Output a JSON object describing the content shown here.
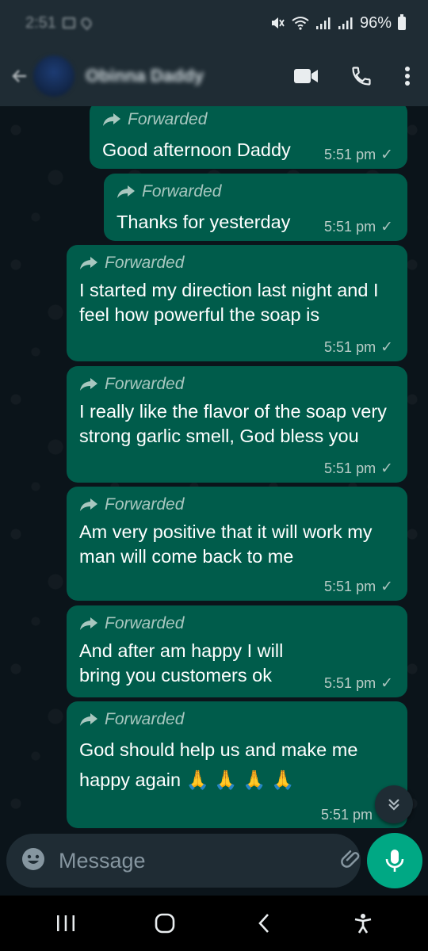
{
  "status_bar": {
    "time": "2:51",
    "battery": "96%",
    "icons": [
      "image-icon",
      "location-icon",
      "mute-icon",
      "wifi-icon",
      "signal-icon",
      "signal-icon",
      "battery-icon"
    ]
  },
  "header": {
    "contact_name": "Obinna Daddy",
    "actions": [
      "video-call-icon",
      "voice-call-icon",
      "more-options-icon"
    ]
  },
  "messages": [
    {
      "forwarded_label": "Forwarded",
      "text": "Good afternoon Daddy",
      "time": "5:51 pm",
      "status": "sent-check"
    },
    {
      "forwarded_label": "Forwarded",
      "text": "Thanks for yesterday",
      "time": "5:51 pm",
      "status": "sent-check"
    },
    {
      "forwarded_label": "Forwarded",
      "text": "I started my direction last night and I feel how powerful the soap is",
      "time": "5:51 pm",
      "status": "sent-check"
    },
    {
      "forwarded_label": "Forwarded",
      "text": "I really like the flavor of the soap very strong garlic smell, God bless you",
      "time": "5:51 pm",
      "status": "sent-check"
    },
    {
      "forwarded_label": "Forwarded",
      "text": "Am very positive that it will work my man will come back to me",
      "time": "5:51 pm",
      "status": "sent-check"
    },
    {
      "forwarded_label": "Forwarded",
      "text": "And after am happy I will bring you customers ok",
      "time": "5:51 pm",
      "status": "sent-check"
    },
    {
      "forwarded_label": "Forwarded",
      "text": "God should help us and make me happy again 🙏 🙏 🙏 🙏",
      "time": "5:51 pm",
      "status": "sent-check"
    }
  ],
  "input": {
    "placeholder": "Message"
  },
  "colors": {
    "background": "#0b141a",
    "header": "#1f2c34",
    "outgoing_bubble": "#005c4b",
    "accent": "#00a884"
  }
}
